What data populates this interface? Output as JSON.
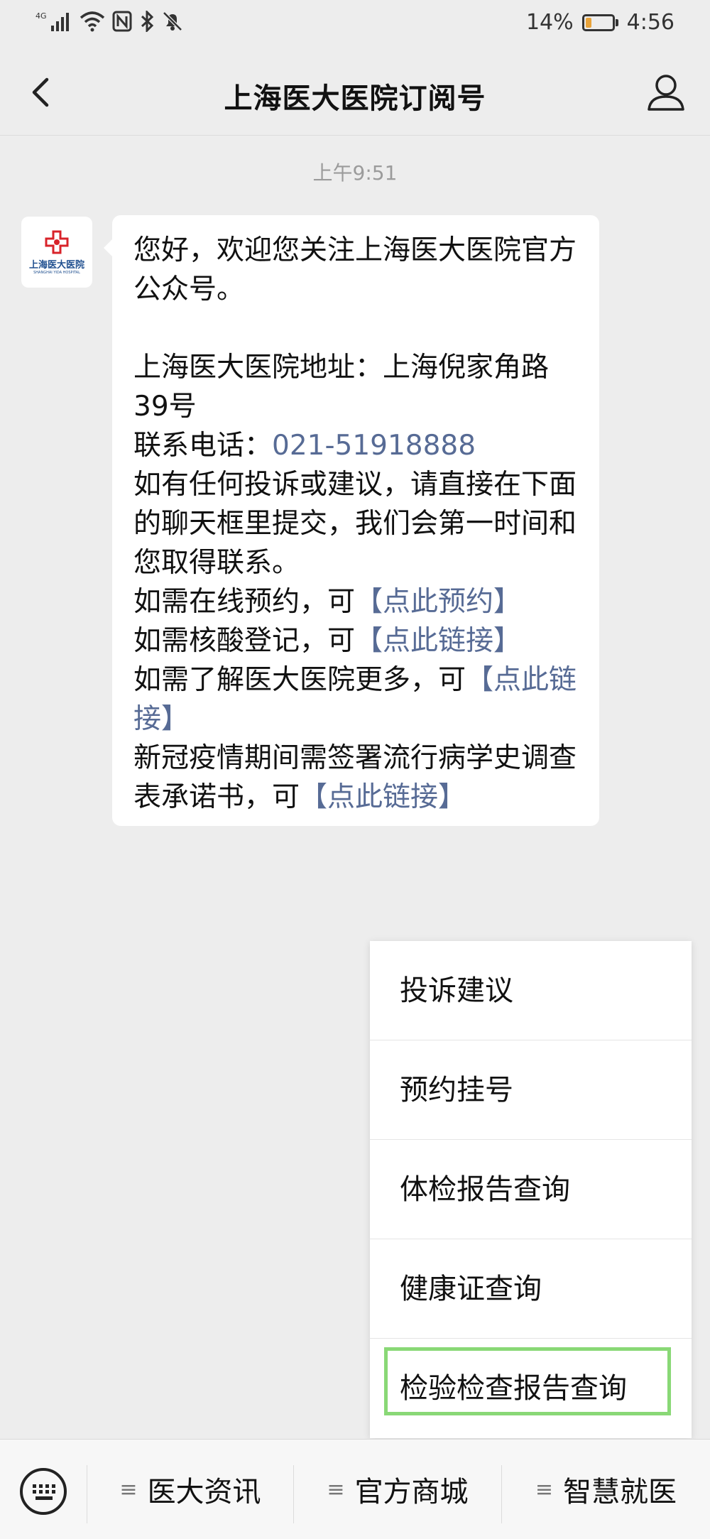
{
  "status_bar": {
    "network": "4G",
    "battery_percent": "14%",
    "time": "4:56"
  },
  "header": {
    "title": "上海医大医院订阅号"
  },
  "chat": {
    "timestamp": "上午9:51",
    "avatar": {
      "logo_text": "上海医大医院",
      "logo_subtext": "SHANGHAI YIDA HOSPITAL"
    },
    "message": {
      "line_1": "您好，欢迎您关注上海医大医院官方公众号。",
      "address": "上海医大医院地址：上海倪家角路39号",
      "phone_label": "联系电话：",
      "phone_number": "021-51918888",
      "complaint": "如有任何投诉或建议，请直接在下面的聊天框里提交，我们会第一时间和您取得联系。",
      "booking_prefix": "如需在线预约，可",
      "booking_link": "【点此预约】",
      "nucleic_prefix": "如需核酸登记，可",
      "nucleic_link": "【点此链接】",
      "more_prefix": "如需了解医大医院更多，可",
      "more_link": "【点此链接】",
      "covid_prefix": "新冠疫情期间需签署流行病学史调查表承诺书，可",
      "covid_link": "【点此链接】"
    }
  },
  "popup_menu": {
    "items": [
      {
        "label": "投诉建议"
      },
      {
        "label": "预约挂号"
      },
      {
        "label": "体检报告查询"
      },
      {
        "label": "健康证查询"
      },
      {
        "label": "检验检查报告查询",
        "highlighted": true
      }
    ]
  },
  "bottom_menu": {
    "tabs": [
      {
        "label": "医大资讯"
      },
      {
        "label": "官方商城"
      },
      {
        "label": "智慧就医"
      }
    ],
    "tab_icon": "≡"
  },
  "colors": {
    "background": "#ededed",
    "link": "#576b95",
    "highlight_border": "#89d876",
    "logo_red": "#d8232a",
    "logo_blue": "#1f4f8f"
  }
}
